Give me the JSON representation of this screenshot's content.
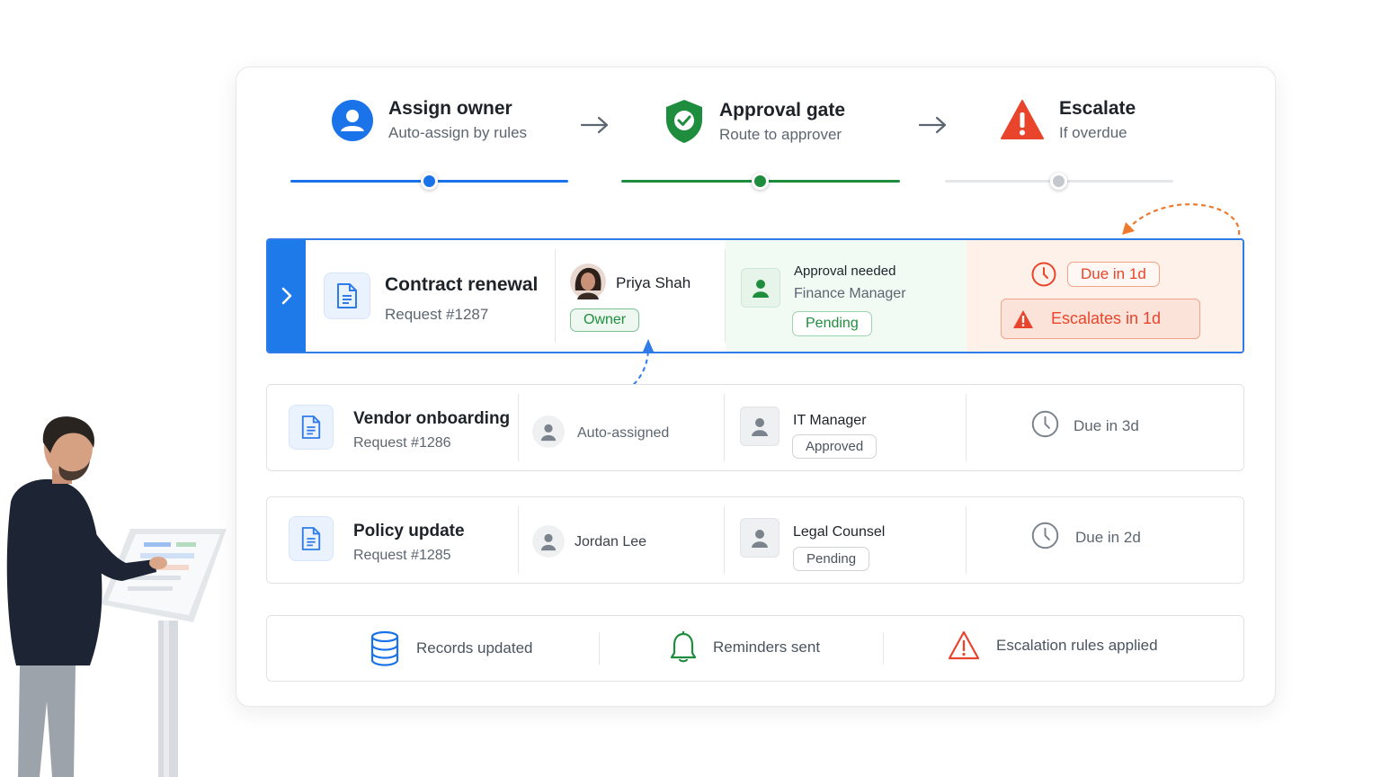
{
  "steps": [
    {
      "title": "Assign owner",
      "subtitle": "Auto-assign by rules",
      "icon": "person-icon",
      "color": "#1a73e8"
    },
    {
      "title": "Approval gate",
      "subtitle": "Route to approver",
      "icon": "shield-check-icon",
      "color": "#1e8e3e"
    },
    {
      "title": "Escalate",
      "subtitle": "If overdue",
      "icon": "warning-icon",
      "color": "#e8452c"
    }
  ],
  "rows": [
    {
      "title": "Contract renewal",
      "request": "Request #1287",
      "owner": "Priya Shah",
      "owner_badge": "Owner",
      "approval_label": "Approval needed",
      "approver": "Finance Manager",
      "approval_status": "Pending",
      "due": "Due in 1d",
      "escalation": "Escalates in 1d"
    },
    {
      "title": "Vendor onboarding",
      "request": "Request #1286",
      "owner": "Auto-assigned",
      "approver": "IT Manager",
      "approval_status": "Approved",
      "due": "Due in 3d"
    },
    {
      "title": "Policy update",
      "request": "Request #1285",
      "owner": "Jordan Lee",
      "approver": "Legal Counsel",
      "approval_status": "Pending",
      "due": "Due in 2d"
    }
  ],
  "footer": [
    {
      "label": "Records updated",
      "icon": "database-icon"
    },
    {
      "label": "Reminders sent",
      "icon": "bell-icon"
    },
    {
      "label": "Escalation rules applied",
      "icon": "warning-outline-icon"
    }
  ],
  "colors": {
    "blue": "#1a73e8",
    "green": "#1e8e3e",
    "orange": "#e8452c",
    "gray": "#c5c9ce"
  }
}
